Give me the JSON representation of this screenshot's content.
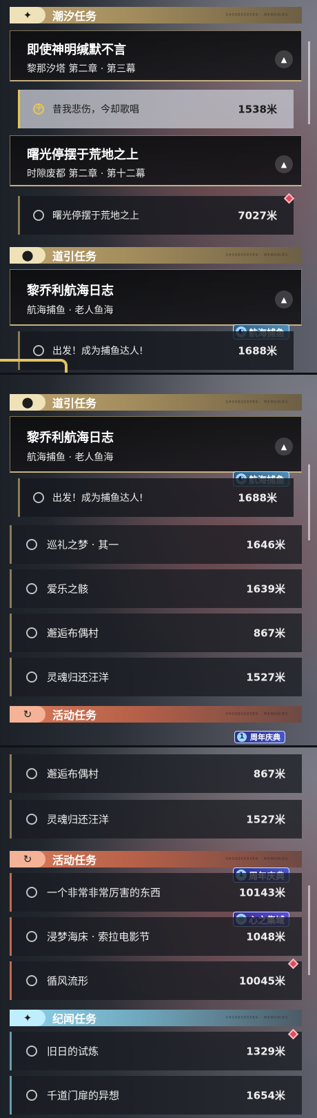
{
  "categories": {
    "tide": "潮汐任务",
    "guide": "道引任务",
    "event": "活动任务",
    "chronicle": "纪闻任务"
  },
  "header_tag": "SHOREKEEPER · MEMORIES",
  "quests": {
    "q1": {
      "title": "即使神明缄默不言",
      "subtitle": "黎那汐塔 第二章 · 第三幕"
    },
    "q1_step": {
      "label": "昔我悲伤，今却歌唱",
      "distance": "1538米"
    },
    "q2": {
      "title": "曙光停摆于荒地之上",
      "subtitle": "时隙废都 第二章 · 第十二幕"
    },
    "q2_step": {
      "label": "曙光停摆于荒地之上",
      "distance": "7027米"
    },
    "q3": {
      "title": "黎乔利航海日志",
      "subtitle": "航海捕鱼 · 老人鱼海"
    },
    "q3_step": {
      "label": "出发！成为捕鱼达人!",
      "distance": "1688米"
    }
  },
  "guide_rows": [
    {
      "label": "巡礼之梦 · 其一",
      "distance": "1646米"
    },
    {
      "label": "爱乐之骸",
      "distance": "1639米"
    },
    {
      "label": "邂逅布偶村",
      "distance": "867米"
    },
    {
      "label": "灵魂归还汪洋",
      "distance": "1527米"
    }
  ],
  "event_rows": [
    {
      "label": "一个非常非常厉害的东西",
      "distance": "10143米"
    },
    {
      "label": "浸梦海床 · 索拉电影节",
      "distance": "1048米"
    },
    {
      "label": "循风流形",
      "distance": "10045米"
    }
  ],
  "chronicle_rows": [
    {
      "label": "旧日的试炼",
      "distance": "1329米"
    },
    {
      "label": "千道门扉的异想",
      "distance": "1654米"
    }
  ],
  "badges": {
    "fishing": "航海捕鱼",
    "anniversary": "周年庆典",
    "anniversary_cut": "周年庆典",
    "heart": "心之集域"
  },
  "icons": {
    "tide": "sparkle-icon",
    "guide": "location-pin-icon",
    "event": "refresh-arrow-icon",
    "chronicle": "sparkle-icon",
    "nav": "navigation-arrow-icon",
    "track": "target-circle-icon"
  },
  "colors": {
    "gold": "#bfa570",
    "orange": "#d97b58",
    "blue": "#8fd5ee",
    "highlight": "#e9c84a",
    "diamond": "#e4495a"
  }
}
